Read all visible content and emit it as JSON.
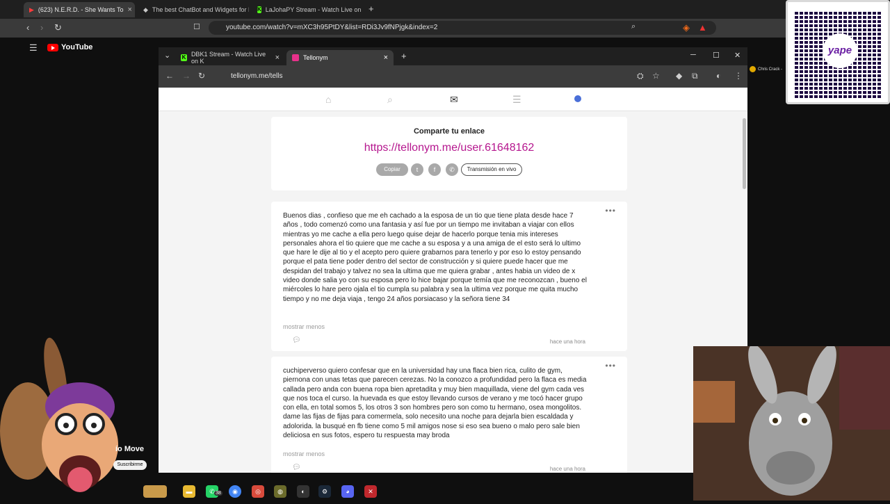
{
  "outer_browser": {
    "tabs": [
      {
        "label": "(623) N.E.R.D. - She Wants To"
      },
      {
        "label": "The best ChatBot and Widgets for K"
      },
      {
        "label": "LaJohaPY Stream - Watch Live on"
      }
    ],
    "url": "youtube.com/watch?v=mXC3h95PtDY&list=RDi3Jv9fNPjgk&index=2",
    "youtube_logo": "YouTube"
  },
  "inner_browser": {
    "tabs": [
      {
        "label": "DBK1 Stream - Watch Live on K"
      },
      {
        "label": "Tellonym"
      }
    ],
    "url": "tellonym.me/tells"
  },
  "tellonym": {
    "share": {
      "title": "Comparte tu enlace",
      "link": "https://tellonym.me/user.61648162",
      "copy_label": "Copiar",
      "live_label": "Transmisión en vivo"
    },
    "tells": [
      {
        "text": "Buenos dias , confieso que me eh cachado a la esposa de un tio que tiene plata desde hace 7 años , todo comenzó como una fantasia  y así fue por un tiempo me invitaban a viajar con ellos mientras yo me cache a ella pero luego quise dejar de hacerlo porque tenia mis intereses personales ahora el tio quiere que me cache a su esposa y a una amiga de el esto será lo ultimo que hare le dije al tio y el acepto pero quiere grabarnos para tenerlo y por eso lo estoy pensando porque  el pata tiene poder dentro del sector de construcción y si quiere puede hacer que me despidan del trabajo y talvez no sea la ultima que me quiera grabar , antes habia un video de x video donde salia yo con su esposa pero lo hice bajar porque temía que me reconozcan , bueno el miércoles lo hare pero ojala el tio cumpla su palabra y sea la ultima vez porque me quita mucho tiempo y no me deja viaja , tengo 24 años porsiacaso y la señora tiene 34",
        "more": "mostrar menos",
        "time": "hace una hora"
      },
      {
        "text": "cuchiperverso quiero confesar que en la universidad hay una flaca bien rica, culito de gym, piernona con unas tetas que parecen cerezas. No la conozco a profundidad pero la  flaca es media callada pero anda con buena ropa bien apretadita y muy bien maquillada, viene del gym cada ves que nos toca el curso. la huevada es que estoy llevando cursos de verano y me tocó hacer grupo con ella, en total somos 5, los otros 3 son hombres pero son como tu hermano, osea mongolitos. dame las fijas de fijas para comermela, solo necesito una noche para dejarla bien escaldada y adolorida. la busqué en fb tiene como 5 mil amigos nose si eso sea bueno o malo pero sale bien deliciosa en sus fotos, espero tu respuesta may broda",
        "more": "mostrar menos",
        "time": "hace una hora"
      }
    ]
  },
  "overlay": {
    "side_user": "Chris Crack -",
    "yt_channel_fragment": "ío Move",
    "yt_subscribe": "Suscribirme",
    "qr_brand": "yape",
    "taskbar_badge": "38"
  },
  "colors": {
    "tellonym_accent": "#b5168e",
    "page_bg": "#f4f4f4",
    "browser_dark": "#3c3c3c"
  }
}
